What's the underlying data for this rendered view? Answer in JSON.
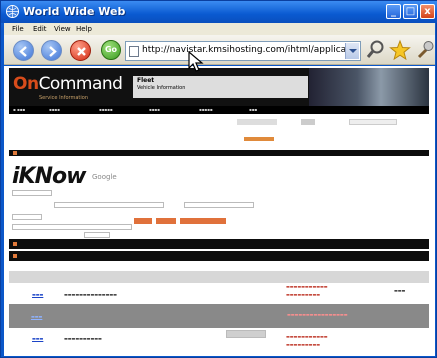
{
  "window": {
    "title": "World Wide Web",
    "controls": {
      "minimize": "_",
      "maximize": "□",
      "close": "x"
    }
  },
  "menubar": {
    "items": [
      "File",
      "Edit",
      "View",
      "Help"
    ]
  },
  "toolbar": {
    "go_label": "Go",
    "url": "http://navistar.kmsihosting.com/ihtml/application/stu"
  },
  "page": {
    "logo": {
      "prefix": "",
      "on": "On",
      "rest": "Command",
      "sub": "Service Information"
    },
    "header_box": {
      "title": "Fleet",
      "subtitle": "Vehicle Information"
    },
    "iknow": {
      "title": "iKNow",
      "subtitle": "Google"
    },
    "orange_button_labels": [
      "",
      "",
      ""
    ]
  },
  "colors": {
    "accent_orange": "#e0713b",
    "link_blue": "#1b44c7",
    "frame_blue": "#0b5fc6"
  }
}
